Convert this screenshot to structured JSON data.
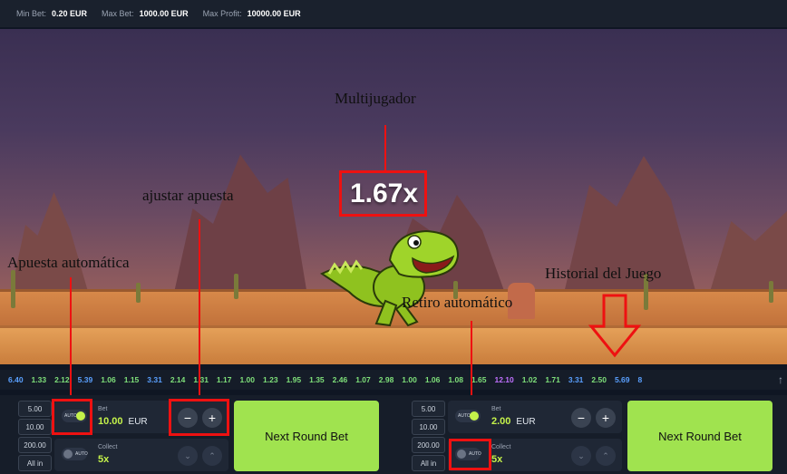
{
  "topbar": {
    "min_bet_label": "Min Bet:",
    "min_bet_value": "0.20 EUR",
    "max_bet_label": "Max Bet:",
    "max_bet_value": "1000.00 EUR",
    "max_profit_label": "Max Profit:",
    "max_profit_value": "10000.00 EUR"
  },
  "game": {
    "multiplier": "1.67x"
  },
  "annotations": {
    "multiplayer": "Multijugador",
    "adjust_bet": "ajustar apuesta",
    "auto_bet": "Apuesta automática",
    "game_history": "Historial del Juego",
    "auto_cashout": "Retiro automático"
  },
  "history": [
    {
      "v": "6.40",
      "c": "#5aa0ff"
    },
    {
      "v": "1.33",
      "c": "#7fe07a"
    },
    {
      "v": "2.12",
      "c": "#7fe07a"
    },
    {
      "v": "5.39",
      "c": "#5aa0ff"
    },
    {
      "v": "1.06",
      "c": "#7fe07a"
    },
    {
      "v": "1.15",
      "c": "#7fe07a"
    },
    {
      "v": "3.31",
      "c": "#5aa0ff"
    },
    {
      "v": "2.14",
      "c": "#7fe07a"
    },
    {
      "v": "1.31",
      "c": "#7fe07a"
    },
    {
      "v": "1.17",
      "c": "#7fe07a"
    },
    {
      "v": "1.00",
      "c": "#7fe07a"
    },
    {
      "v": "1.23",
      "c": "#7fe07a"
    },
    {
      "v": "1.95",
      "c": "#7fe07a"
    },
    {
      "v": "1.35",
      "c": "#7fe07a"
    },
    {
      "v": "2.46",
      "c": "#7fe07a"
    },
    {
      "v": "1.07",
      "c": "#7fe07a"
    },
    {
      "v": "2.98",
      "c": "#7fe07a"
    },
    {
      "v": "1.00",
      "c": "#7fe07a"
    },
    {
      "v": "1.06",
      "c": "#7fe07a"
    },
    {
      "v": "1.08",
      "c": "#7fe07a"
    },
    {
      "v": "1.65",
      "c": "#7fe07a"
    },
    {
      "v": "12.10",
      "c": "#c070ff"
    },
    {
      "v": "1.02",
      "c": "#7fe07a"
    },
    {
      "v": "1.71",
      "c": "#7fe07a"
    },
    {
      "v": "3.31",
      "c": "#5aa0ff"
    },
    {
      "v": "2.50",
      "c": "#7fe07a"
    },
    {
      "v": "5.69",
      "c": "#5aa0ff"
    },
    {
      "v": "8",
      "c": "#5aa0ff"
    }
  ],
  "panels": [
    {
      "quick": [
        "5.00",
        "10.00",
        "200.00",
        "All in"
      ],
      "auto_label": "AUTO",
      "bet_label": "Bet",
      "bet_value": "10.00",
      "currency": "EUR",
      "collect_label": "Collect",
      "collect_value": "5x",
      "next_round": "Next Round Bet"
    },
    {
      "quick": [
        "5.00",
        "10.00",
        "200.00",
        "All in"
      ],
      "auto_label": "AUTO",
      "bet_label": "Bet",
      "bet_value": "2.00",
      "currency": "EUR",
      "collect_label": "Collect",
      "collect_value": "5x",
      "next_round": "Next Round Bet"
    }
  ]
}
